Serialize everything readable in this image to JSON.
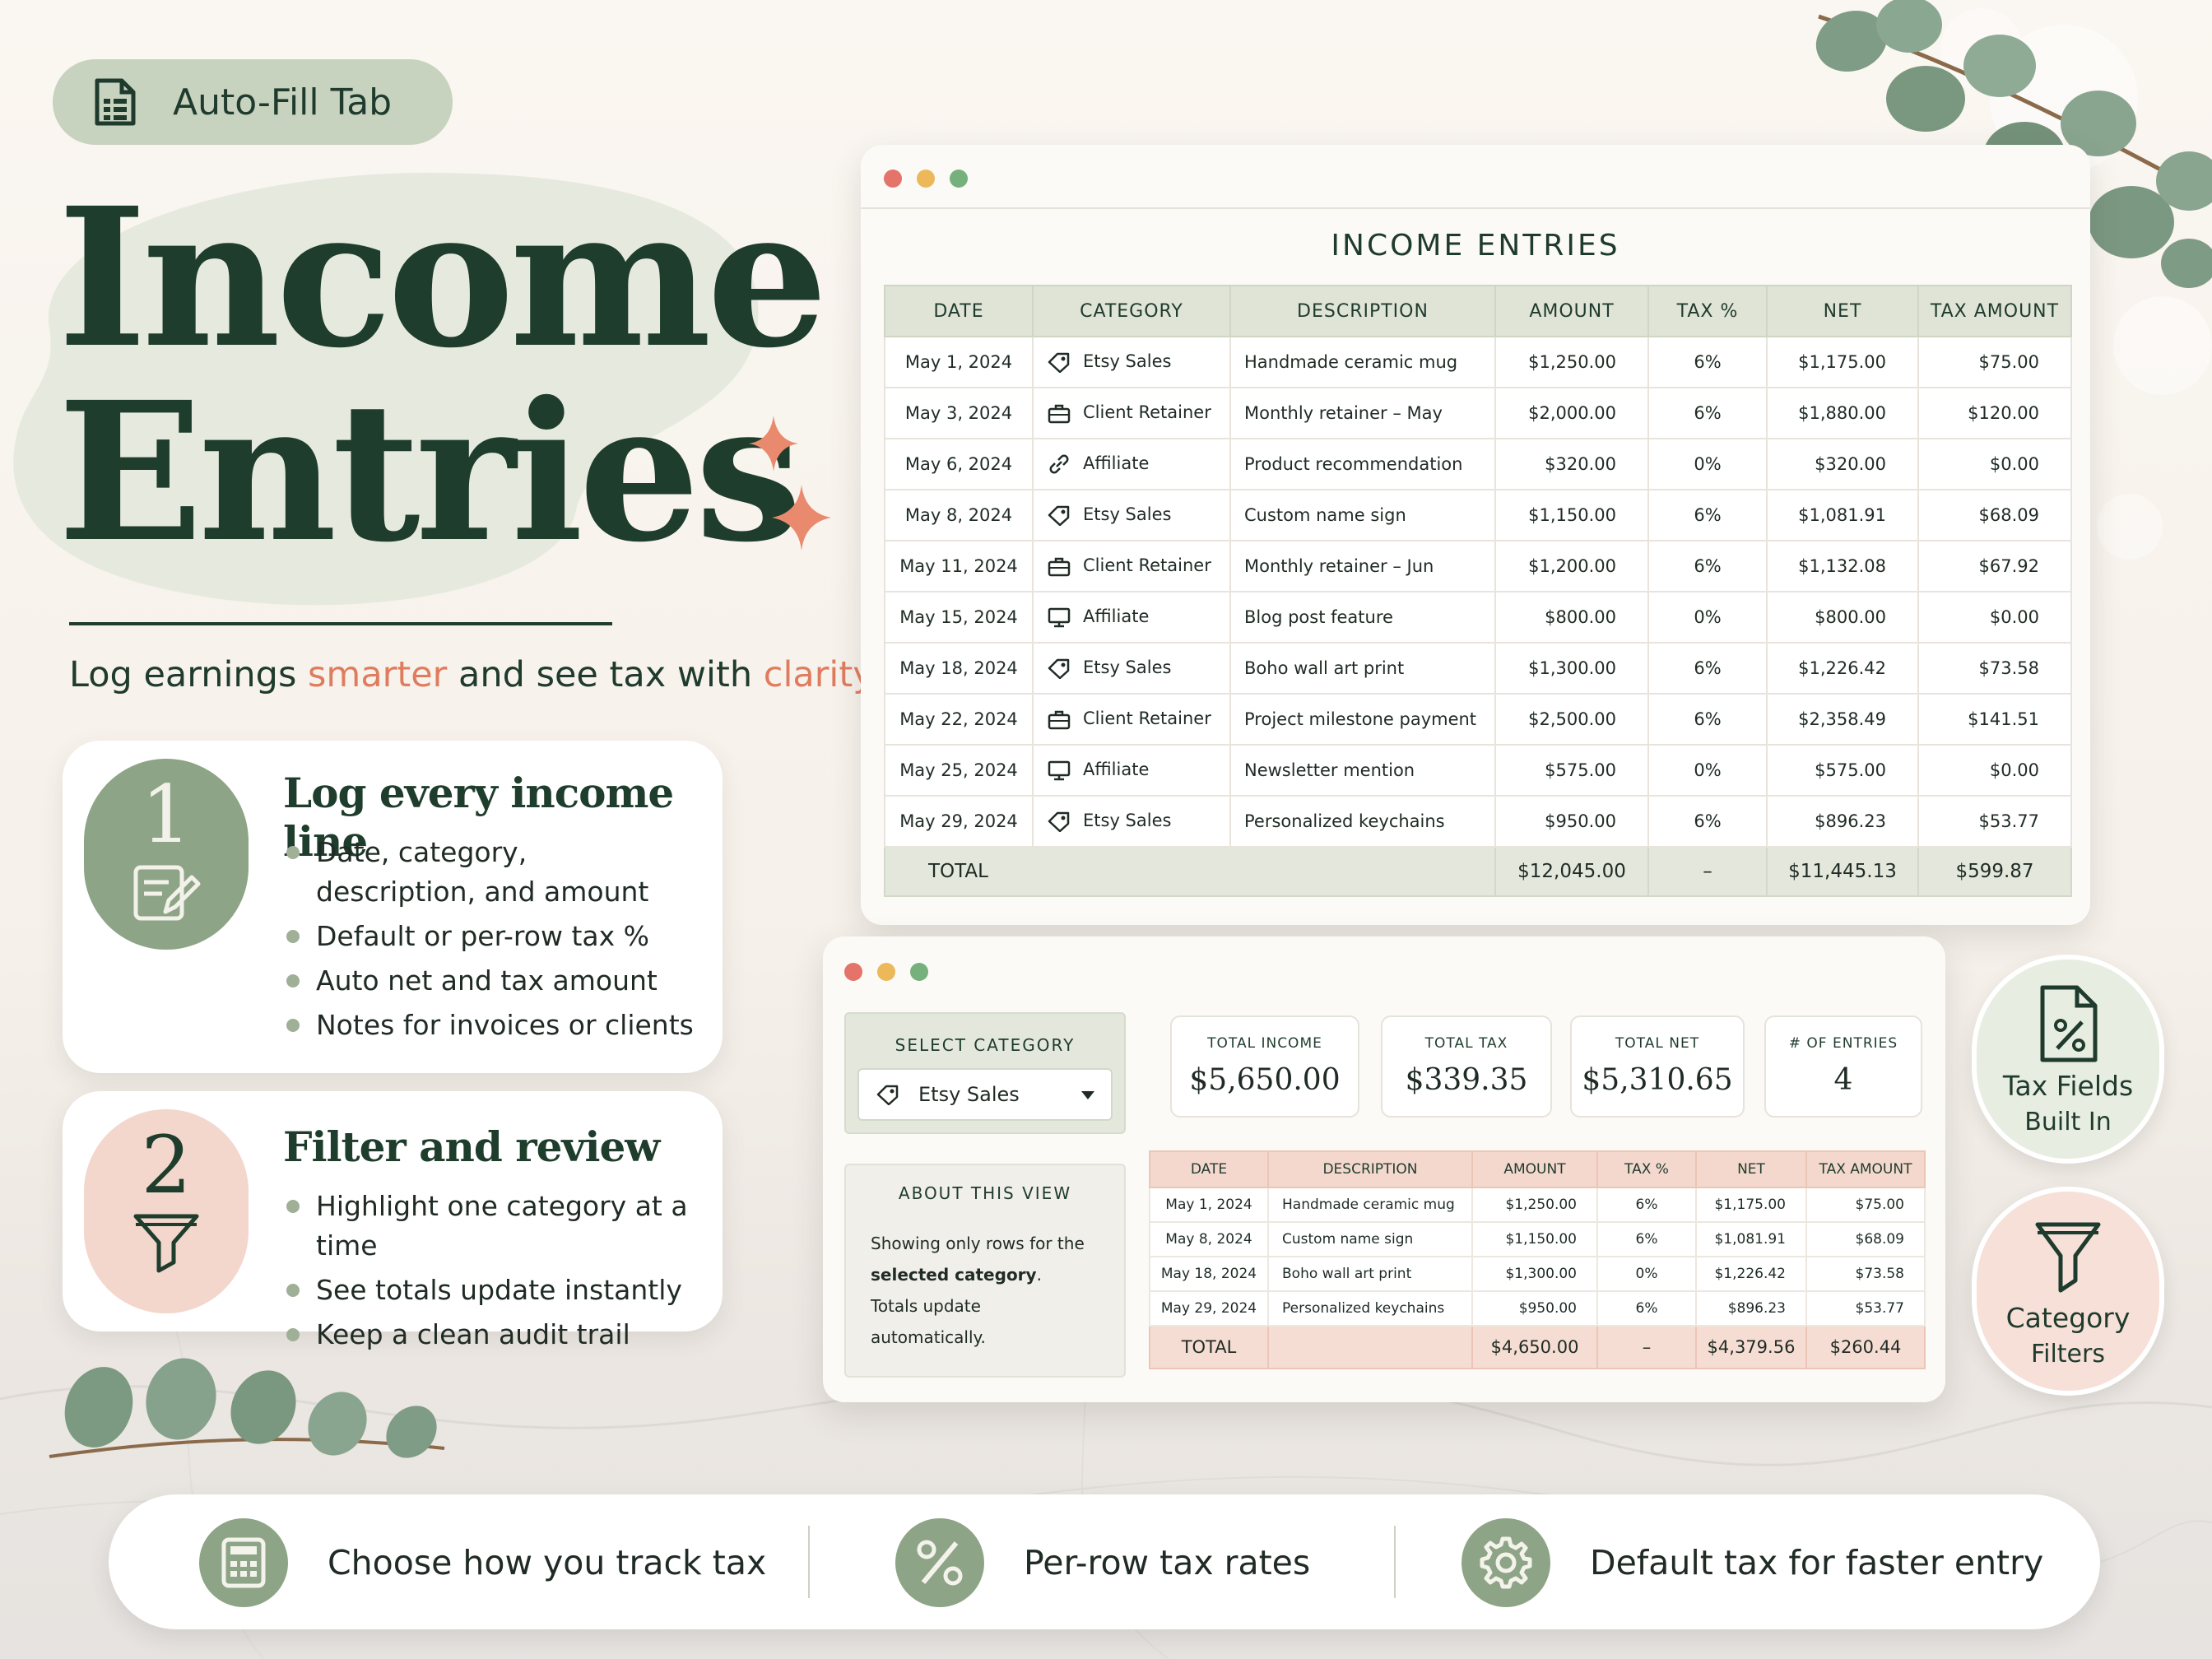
{
  "badge": {
    "label": "Auto-Fill Tab",
    "icon": "spreadsheet-icon"
  },
  "hero": {
    "title_line1": "Income",
    "title_line2": "Entries",
    "subtitle_pre": "Log earnings ",
    "subtitle_accent1": "smarter",
    "subtitle_mid": " and see tax with ",
    "subtitle_accent2": "clarity"
  },
  "features": [
    {
      "number": "1",
      "title": "Log every income line",
      "bullets": [
        "Date, category, description, and amount",
        "Default or per-row tax %",
        "Auto net and tax amount",
        "Notes for invoices or clients"
      ]
    },
    {
      "number": "2",
      "title": "Filter and review",
      "bullets": [
        "Highlight one category at a time",
        "See totals update instantly",
        "Keep a clean audit trail"
      ]
    }
  ],
  "income_window": {
    "title": "INCOME ENTRIES",
    "columns": [
      "DATE",
      "CATEGORY",
      "DESCRIPTION",
      "AMOUNT",
      "TAX %",
      "NET",
      "TAX AMOUNT"
    ],
    "rows": [
      {
        "date": "May 1, 2024",
        "category": "Etsy Sales",
        "icon": "tag-icon",
        "description": "Handmade ceramic mug",
        "amount": "$1,250.00",
        "tax": "6%",
        "net": "$1,175.00",
        "tax_amount": "$75.00"
      },
      {
        "date": "May 3, 2024",
        "category": "Client Retainer",
        "icon": "briefcase-icon",
        "description": "Monthly retainer – May",
        "amount": "$2,000.00",
        "tax": "6%",
        "net": "$1,880.00",
        "tax_amount": "$120.00"
      },
      {
        "date": "May 6, 2024",
        "category": "Affiliate",
        "icon": "link-icon",
        "description": "Product recommendation",
        "amount": "$320.00",
        "tax": "0%",
        "net": "$320.00",
        "tax_amount": "$0.00"
      },
      {
        "date": "May 8, 2024",
        "category": "Etsy Sales",
        "icon": "tag-icon",
        "description": "Custom name sign",
        "amount": "$1,150.00",
        "tax": "6%",
        "net": "$1,081.91",
        "tax_amount": "$68.09"
      },
      {
        "date": "May 11, 2024",
        "category": "Client Retainer",
        "icon": "briefcase-icon",
        "description": "Monthly retainer – Jun",
        "amount": "$1,200.00",
        "tax": "6%",
        "net": "$1,132.08",
        "tax_amount": "$67.92"
      },
      {
        "date": "May 15, 2024",
        "category": "Affiliate",
        "icon": "monitor-icon",
        "description": "Blog post feature",
        "amount": "$800.00",
        "tax": "0%",
        "net": "$800.00",
        "tax_amount": "$0.00"
      },
      {
        "date": "May 18, 2024",
        "category": "Etsy Sales",
        "icon": "tag-icon",
        "description": "Boho wall art print",
        "amount": "$1,300.00",
        "tax": "6%",
        "net": "$1,226.42",
        "tax_amount": "$73.58"
      },
      {
        "date": "May 22, 2024",
        "category": "Client Retainer",
        "icon": "briefcase-icon",
        "description": "Project milestone payment",
        "amount": "$2,500.00",
        "tax": "6%",
        "net": "$2,358.49",
        "tax_amount": "$141.51"
      },
      {
        "date": "May 25, 2024",
        "category": "Affiliate",
        "icon": "monitor-icon",
        "description": "Newsletter mention",
        "amount": "$575.00",
        "tax": "0%",
        "net": "$575.00",
        "tax_amount": "$0.00"
      },
      {
        "date": "May 29, 2024",
        "category": "Etsy Sales",
        "icon": "tag-icon",
        "description": "Personalized keychains",
        "amount": "$950.00",
        "tax": "6%",
        "net": "$896.23",
        "tax_amount": "$53.77"
      }
    ],
    "total": {
      "label": "TOTAL",
      "amount": "$12,045.00",
      "tax": "–",
      "net": "$11,445.13",
      "tax_amount": "$599.87"
    }
  },
  "filter_window": {
    "select_label": "SELECT CATEGORY",
    "select_value": "Etsy Sales",
    "about_title": "ABOUT THIS VIEW",
    "about_text_1": "Showing only rows for the ",
    "about_text_bold": "selected category",
    "about_text_2": ".",
    "about_text_3": "Totals update automatically.",
    "stats": [
      {
        "label": "TOTAL INCOME",
        "value": "$5,650.00"
      },
      {
        "label": "TOTAL TAX",
        "value": "$339.35"
      },
      {
        "label": "TOTAL NET",
        "value": "$5,310.65"
      },
      {
        "label": "# OF ENTRIES",
        "value": "4"
      }
    ],
    "columns": [
      "DATE",
      "DESCRIPTION",
      "AMOUNT",
      "TAX %",
      "NET",
      "TAX AMOUNT"
    ],
    "rows": [
      {
        "date": "May 1, 2024",
        "description": "Handmade ceramic mug",
        "amount": "$1,250.00",
        "tax": "6%",
        "net": "$1,175.00",
        "tax_amount": "$75.00"
      },
      {
        "date": "May 8, 2024",
        "description": "Custom name sign",
        "amount": "$1,150.00",
        "tax": "6%",
        "net": "$1,081.91",
        "tax_amount": "$68.09"
      },
      {
        "date": "May 18, 2024",
        "description": "Boho wall art print",
        "amount": "$1,300.00",
        "tax": "0%",
        "net": "$1,226.42",
        "tax_amount": "$73.58"
      },
      {
        "date": "May 29, 2024",
        "description": "Personalized keychains",
        "amount": "$950.00",
        "tax": "6%",
        "net": "$896.23",
        "tax_amount": "$53.77"
      }
    ],
    "total": {
      "label": "TOTAL",
      "amount": "$4,650.00",
      "tax": "–",
      "net": "$4,379.56",
      "tax_amount": "$260.44"
    }
  },
  "side_badges": [
    {
      "line1": "Tax Fields",
      "line2": "Built In",
      "icon": "percent-document-icon"
    },
    {
      "line1": "Category",
      "line2": "Filters",
      "icon": "funnel-icon"
    }
  ],
  "bottom_bar": [
    {
      "label": "Choose how you track tax",
      "icon": "calculator-icon"
    },
    {
      "label": "Per-row tax rates",
      "icon": "percent-icon"
    },
    {
      "label": "Default tax for faster entry",
      "icon": "gear-icon"
    }
  ],
  "colors": {
    "primary_green": "#1e3d2c",
    "sage": "#8ea486",
    "accent_coral": "#e07c5e",
    "blush": "#f3d6cc"
  }
}
